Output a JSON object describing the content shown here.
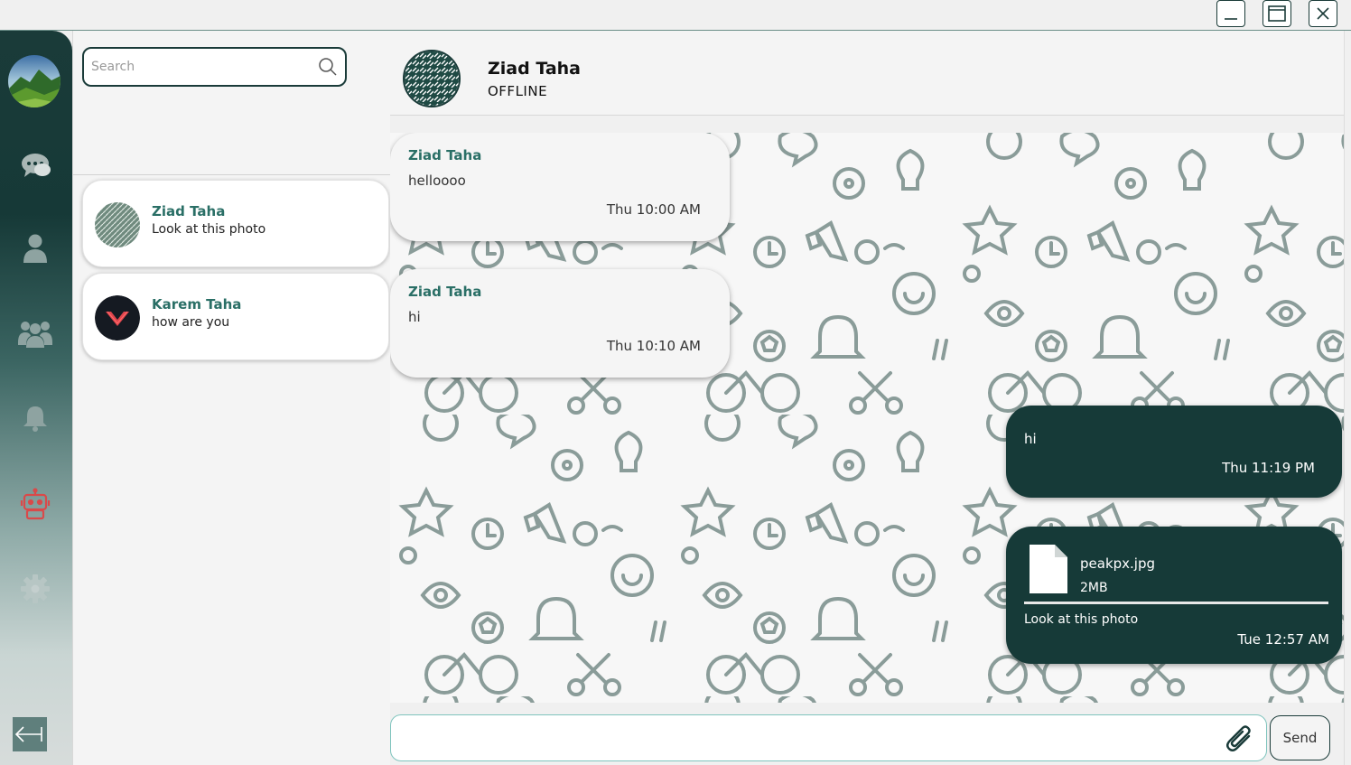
{
  "colors": {
    "brand_dark": "#163a38",
    "accent_name": "#2a6f66",
    "attention": "#d94a4a"
  },
  "window_controls": {
    "minimize_icon": "minimize-icon",
    "maximize_icon": "maximize-icon",
    "close_icon": "close-icon"
  },
  "sidebar": {
    "items": [
      {
        "icon": "chats-icon"
      },
      {
        "icon": "user-icon"
      },
      {
        "icon": "group-icon"
      },
      {
        "icon": "bell-icon"
      },
      {
        "icon": "robot-icon",
        "active": true
      },
      {
        "icon": "gear-icon"
      }
    ],
    "logout_icon": "logout-arrow-icon"
  },
  "search": {
    "placeholder": "Search",
    "value": ""
  },
  "contacts": [
    {
      "name": "Ziad Taha",
      "last_message": "Look at this photo"
    },
    {
      "name": "Karem Taha",
      "last_message": "how are you"
    }
  ],
  "chat": {
    "contact_name": "Ziad Taha",
    "status": "OFFLINE",
    "messages": [
      {
        "direction": "in",
        "sender": "Ziad Taha",
        "text": "helloooo",
        "time": "Thu 10:00 AM"
      },
      {
        "direction": "in",
        "sender": "Ziad Taha",
        "text": "hi",
        "time": "Thu 10:10 AM"
      },
      {
        "direction": "out",
        "text": "hi",
        "time": "Thu 11:19 PM"
      },
      {
        "direction": "out",
        "file_name": "peakpx.jpg",
        "file_size": "2MB",
        "text": "Look at this photo",
        "time": "Tue 12:57 AM"
      }
    ]
  },
  "composer": {
    "value": "",
    "attach_icon": "paperclip-icon",
    "send_label": "Send"
  }
}
